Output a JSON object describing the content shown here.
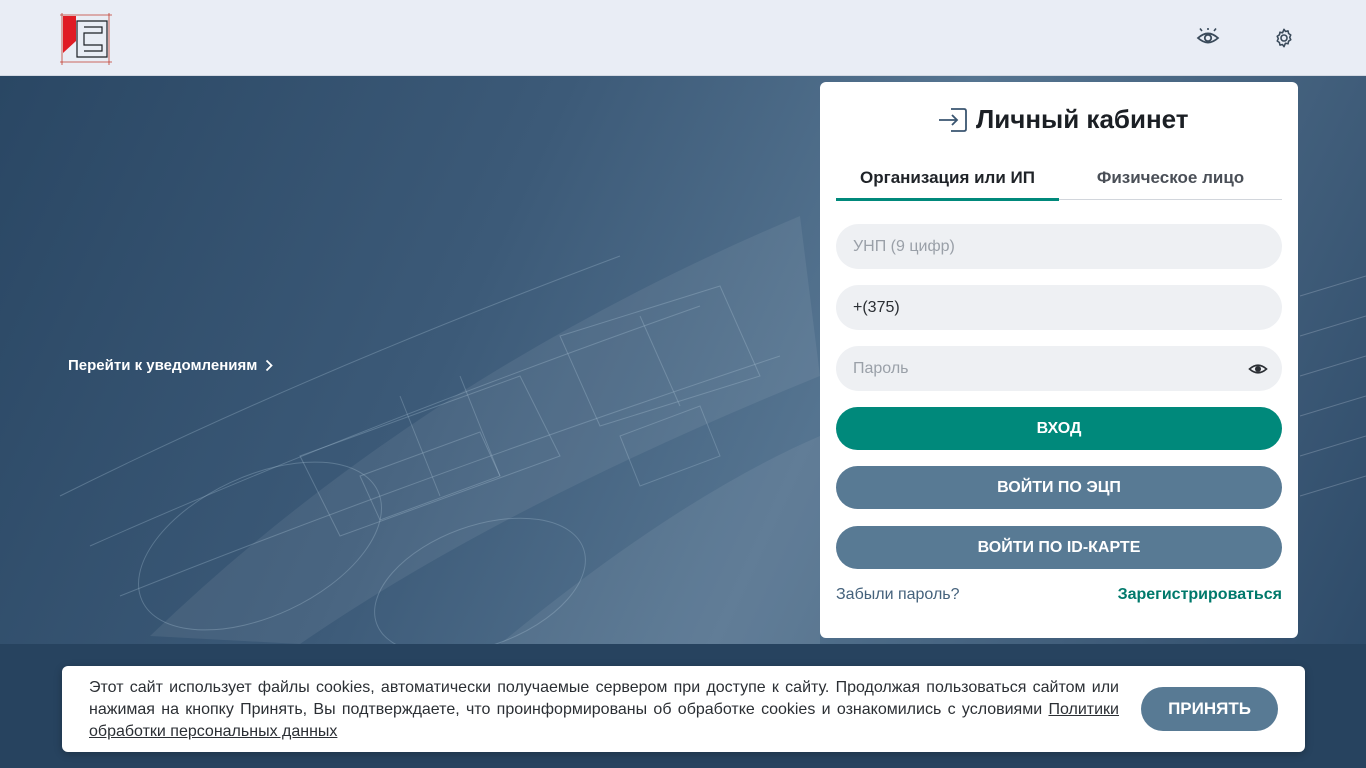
{
  "header": {
    "logo_icon": "company-logo",
    "accessibility_icon": "eye-icon",
    "settings_icon": "gear-icon"
  },
  "hero": {
    "notifications_link": "Перейти к уведомлениям"
  },
  "login": {
    "title": "Личный кабинет",
    "tabs": [
      {
        "label": "Организация или ИП",
        "active": true
      },
      {
        "label": "Физическое лицо",
        "active": false
      }
    ],
    "unp_placeholder": "УНП (9 цифр)",
    "phone_value": "+(375)",
    "password_placeholder": "Пароль",
    "login_button": "ВХОД",
    "ecp_button": "ВОЙТИ ПО ЭЦП",
    "idcard_button": "ВОЙТИ ПО ID-КАРТЕ",
    "forgot_link": "Забыли пароль?",
    "register_link": "Зарегистрироваться"
  },
  "cookie": {
    "text": "Этот сайт использует файлы cookies, автоматически получаемые сервером при доступе к сайту. Продолжая пользоваться сайтом или нажимая на кнопку Принять, Вы подтверждаете, что проинформированы об обработке cookies и ознакомились с условиями ",
    "policy_link": "Политики обработки персональных данных",
    "accept_button": "ПРИНЯТЬ"
  },
  "colors": {
    "accent": "#00897b",
    "secondary": "#587a94",
    "header_bg": "#e9edf5"
  }
}
